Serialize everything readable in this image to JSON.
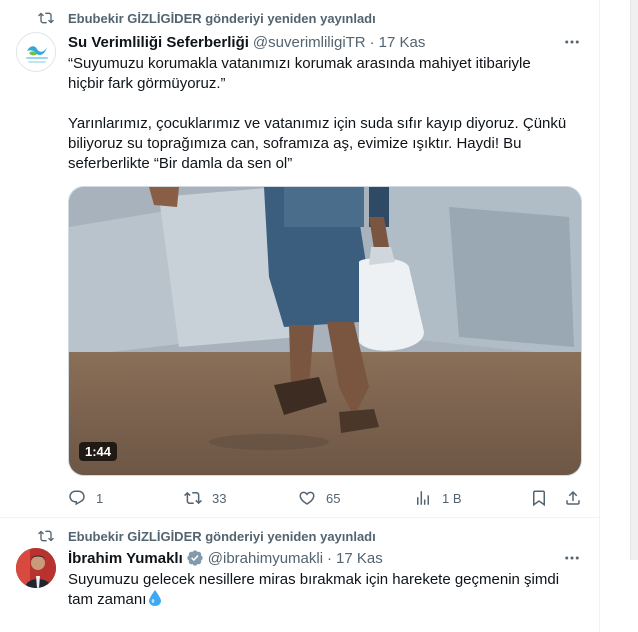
{
  "colors": {
    "text": "#0f1419",
    "secondary": "#536471",
    "border": "#eff3f4",
    "verified": "#829aab",
    "drop": "#3ea8f5"
  },
  "tweet1": {
    "repost_label": "Ebubekir GİZLİGİDER gönderiyi yeniden yayınladı",
    "author_name": "Su Verimliliği Seferberliği",
    "handle": "@suverimliligiTR",
    "dot": "·",
    "time": "17 Kas",
    "lines": [
      "“Suyumuzu korumakla vatanımızı korumak arasında mahiyet itibariyle",
      "hiçbir fark görmüyoruz.”",
      "Yarınlarımız, çocuklarımız ve vatanımız için suda sıfır kayıp diyoruz. Çünkü",
      "biliyoruz su toprağımıza can, soframıza aş, evimize ışıktır. Haydi! Bu",
      "seferberlikte “Bir damla da sen ol”"
    ],
    "video_duration": "1:44",
    "actions": {
      "replies": "1",
      "reposts": "33",
      "likes": "65",
      "views": "1 B"
    },
    "icons": [
      "repost-icon",
      "logo-icon",
      "more-icon",
      "reply-icon",
      "repost-icon",
      "like-icon",
      "views-icon",
      "bookmark-icon",
      "share-icon"
    ]
  },
  "tweet2": {
    "repost_label": "Ebubekir GİZLİGİDER gönderiyi yeniden yayınladı",
    "author_name": "İbrahim Yumaklı",
    "handle": "@ibrahimyumakli",
    "dot": "·",
    "time": "17 Kas",
    "lines": [
      "Suyumuzu gelecek nesillere miras bırakmak için harekete geçmenin şimdi",
      "tam zamanı"
    ],
    "icons": [
      "repost-icon",
      "verified-icon",
      "more-icon",
      "water-drop-icon"
    ]
  }
}
